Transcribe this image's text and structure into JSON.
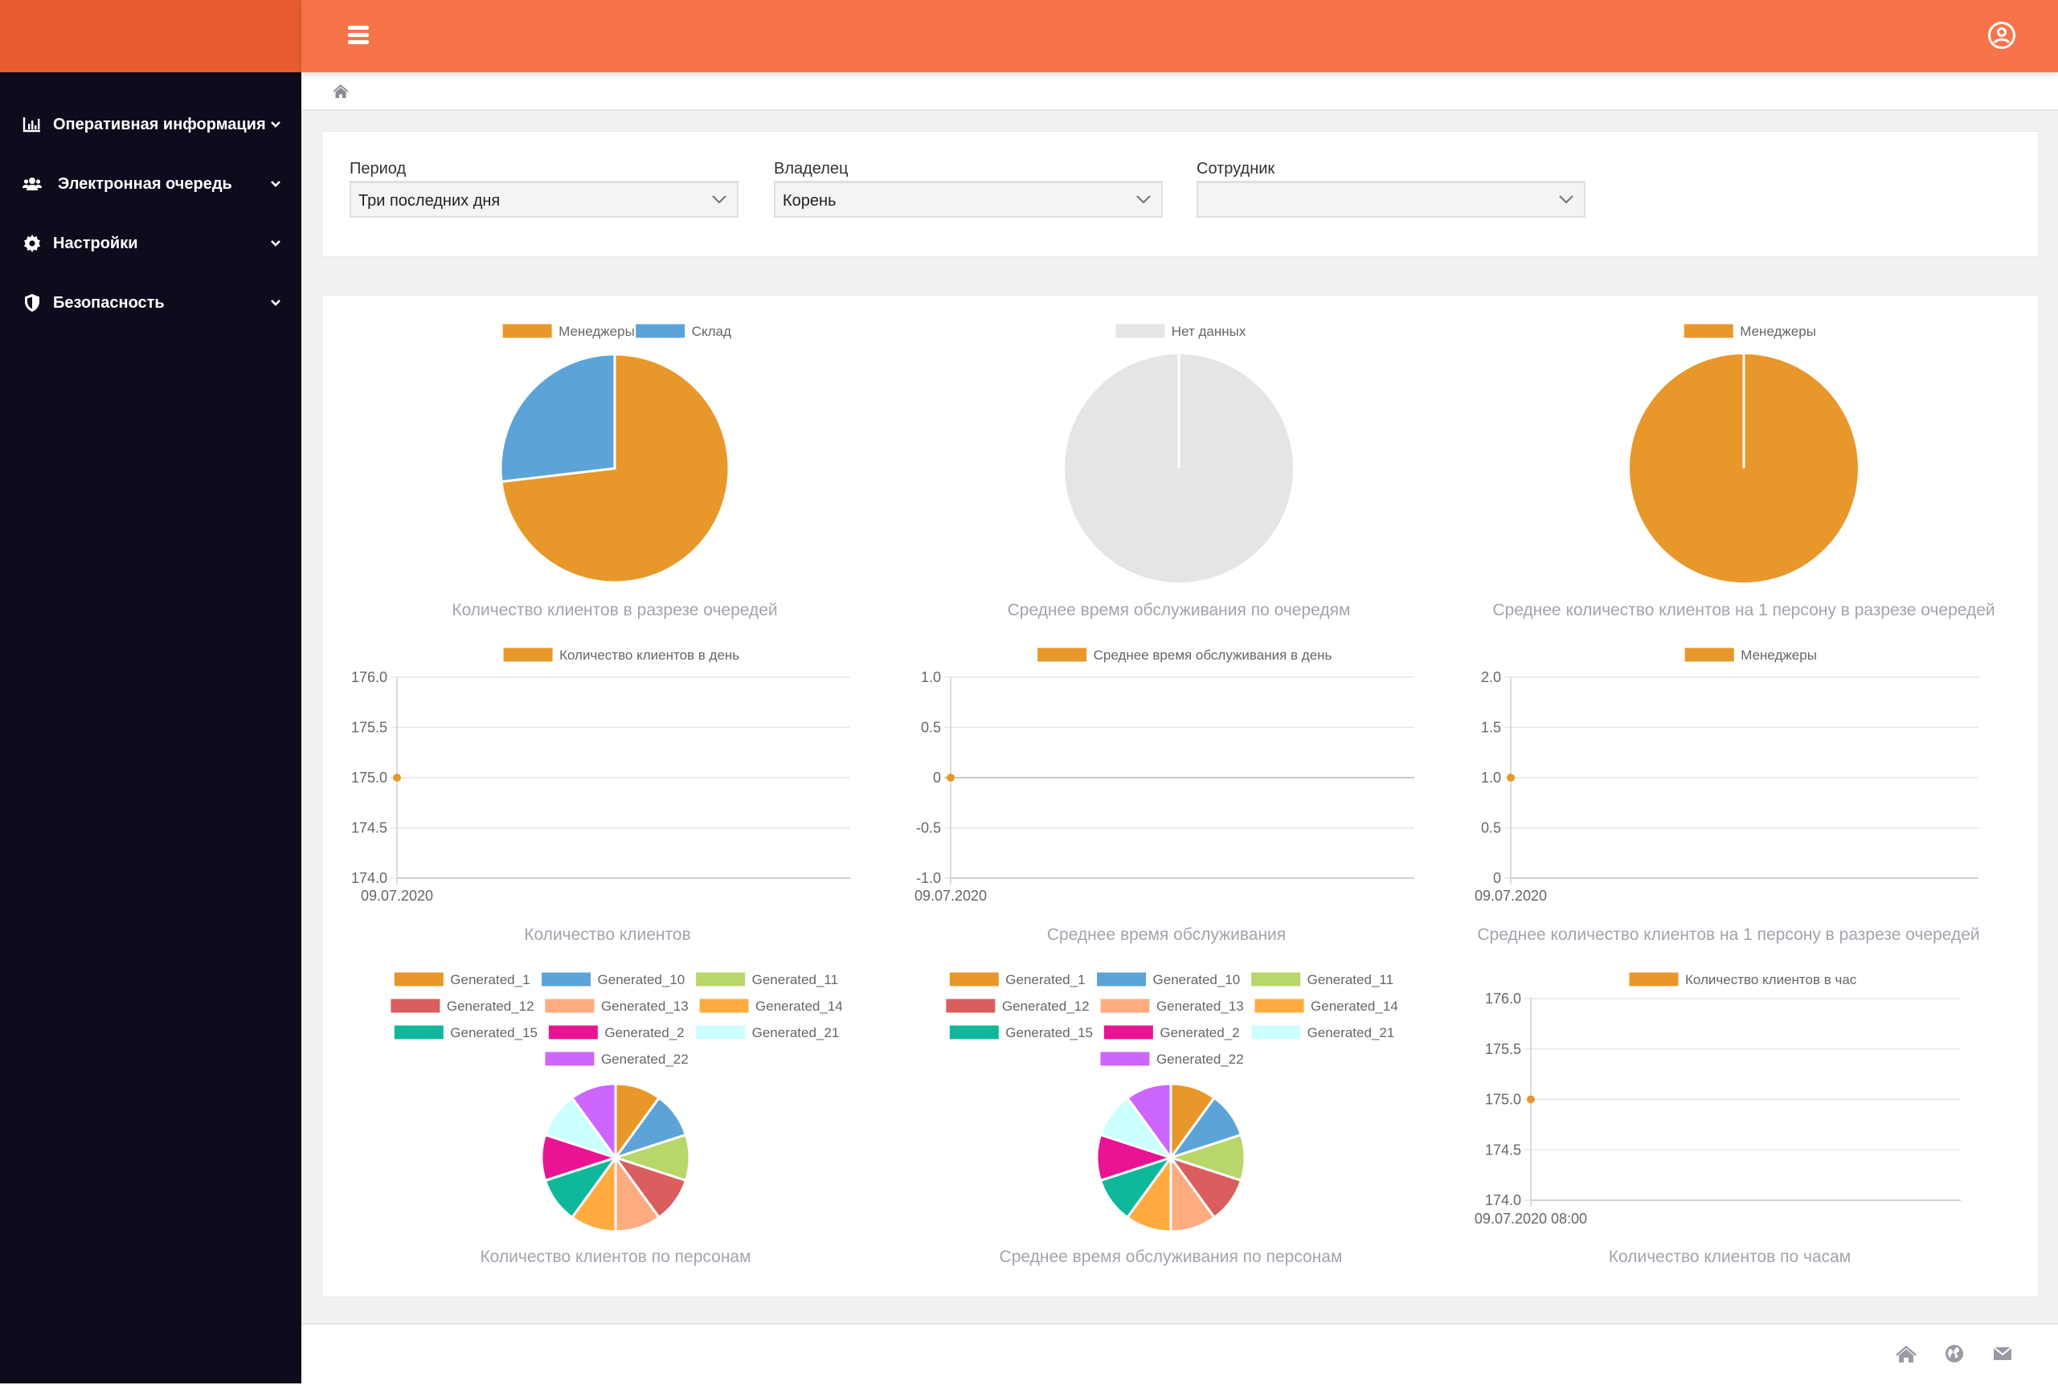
{
  "header": {
    "menu_icon": "hamburger-icon",
    "user_icon": "user-circle-icon"
  },
  "sidebar": {
    "items": [
      {
        "label": "Оперативная информация",
        "icon": "chart-bar-icon"
      },
      {
        "label": "Электронная очередь",
        "icon": "users-icon"
      },
      {
        "label": "Настройки",
        "icon": "gear-icon"
      },
      {
        "label": "Безопасность",
        "icon": "shield-icon"
      }
    ]
  },
  "breadcrumb": {
    "home_icon": "home-icon"
  },
  "filters": {
    "period": {
      "label": "Период",
      "value": "Три последних дня"
    },
    "owner": {
      "label": "Владелец",
      "value": "Корень"
    },
    "employee": {
      "label": "Сотрудник",
      "value": ""
    }
  },
  "footer": {
    "icons": [
      "home-icon",
      "globe-icon",
      "envelope-icon"
    ]
  },
  "colors": {
    "brand": "#e85d30",
    "topbar": "#f7744a",
    "sidebar": "#0d0b1c",
    "series_orange": "#e8972a",
    "no_data": "#e5e5e5"
  },
  "chart_data": [
    {
      "id": "pie-clients-by-queue",
      "type": "pie",
      "title": "Количество клиентов в разрезе очередей",
      "legend_position": "top",
      "categories": [
        "Менеджеры",
        "Склад"
      ],
      "values": [
        128,
        47
      ],
      "colors": [
        "#e8972a",
        "#5ca4d7"
      ]
    },
    {
      "id": "pie-avg-time-by-queue",
      "type": "pie",
      "title": "Среднее время обслуживания по очередям",
      "legend_position": "top",
      "categories": [
        "Нет данных"
      ],
      "values": [
        1
      ],
      "colors": [
        "#e5e5e5"
      ]
    },
    {
      "id": "pie-avg-clients-per-person",
      "type": "pie",
      "title": "Среднее количество клиентов на 1 персону в разрезе очередей",
      "legend_position": "top",
      "categories": [
        "Менеджеры"
      ],
      "values": [
        1
      ],
      "colors": [
        "#e8972a"
      ]
    },
    {
      "id": "line-clients-per-day",
      "type": "line",
      "title": "Количество клиентов",
      "legend_position": "top",
      "x": [
        "09.07.2020"
      ],
      "series": [
        {
          "name": "Количество клиентов в день",
          "values": [
            175
          ],
          "color": "#e8972a"
        }
      ],
      "ylim": [
        174,
        176
      ],
      "yticks": [
        "176.0",
        "175.5",
        "175.0",
        "174.5",
        "174.0"
      ],
      "grid": true
    },
    {
      "id": "line-avg-time-per-day",
      "type": "line",
      "title": "Среднее время обслуживания",
      "legend_position": "top",
      "x": [
        "09.07.2020"
      ],
      "series": [
        {
          "name": "Среднее время обслуживания в день",
          "values": [
            0
          ],
          "color": "#e8972a"
        }
      ],
      "ylim": [
        -1,
        1
      ],
      "yticks": [
        "1.0",
        "0.5",
        "0",
        "-0.5",
        "-1.0"
      ],
      "grid": true
    },
    {
      "id": "line-avg-clients-per-person",
      "type": "line",
      "title": "Среднее количество клиентов на 1 персону в разрезе очередей",
      "legend_position": "top",
      "x": [
        "09.07.2020"
      ],
      "series": [
        {
          "name": "Менеджеры",
          "values": [
            1
          ],
          "color": "#e8972a"
        }
      ],
      "ylim": [
        0,
        2
      ],
      "yticks": [
        "2.0",
        "1.5",
        "1.0",
        "0.5",
        "0"
      ],
      "grid": true
    },
    {
      "id": "pie-clients-by-person",
      "type": "pie",
      "title": "Количество клиентов по персонам",
      "legend_position": "top",
      "categories": [
        "Generated_1",
        "Generated_10",
        "Generated_11",
        "Generated_12",
        "Generated_13",
        "Generated_14",
        "Generated_15",
        "Generated_2",
        "Generated_21",
        "Generated_22"
      ],
      "values": [
        1,
        1,
        1,
        1,
        1,
        1,
        1,
        1,
        1,
        1
      ],
      "colors": [
        "#e8972a",
        "#5ca4d7",
        "#b8d66a",
        "#da5e5e",
        "#ffab80",
        "#ffab40",
        "#0fb89a",
        "#ea1393",
        "#ccffff",
        "#cc66ff"
      ]
    },
    {
      "id": "pie-avg-time-by-person",
      "type": "pie",
      "title": "Среднее время обслуживания по персонам",
      "legend_position": "top",
      "categories": [
        "Generated_1",
        "Generated_10",
        "Generated_11",
        "Generated_12",
        "Generated_13",
        "Generated_14",
        "Generated_15",
        "Generated_2",
        "Generated_21",
        "Generated_22"
      ],
      "values": [
        1,
        1,
        1,
        1,
        1,
        1,
        1,
        1,
        1,
        1
      ],
      "colors": [
        "#e8972a",
        "#5ca4d7",
        "#b8d66a",
        "#da5e5e",
        "#ffab80",
        "#ffab40",
        "#0fb89a",
        "#ea1393",
        "#ccffff",
        "#cc66ff"
      ]
    },
    {
      "id": "line-clients-per-hour",
      "type": "line",
      "title": "Количество клиентов по часам",
      "legend_position": "top",
      "x": [
        "09.07.2020 08:00"
      ],
      "series": [
        {
          "name": "Количество клиентов в час",
          "values": [
            175
          ],
          "color": "#e8972a"
        }
      ],
      "ylim": [
        174,
        176
      ],
      "yticks": [
        "176.0",
        "175.5",
        "175.0",
        "174.5",
        "174.0"
      ],
      "grid": true
    }
  ]
}
